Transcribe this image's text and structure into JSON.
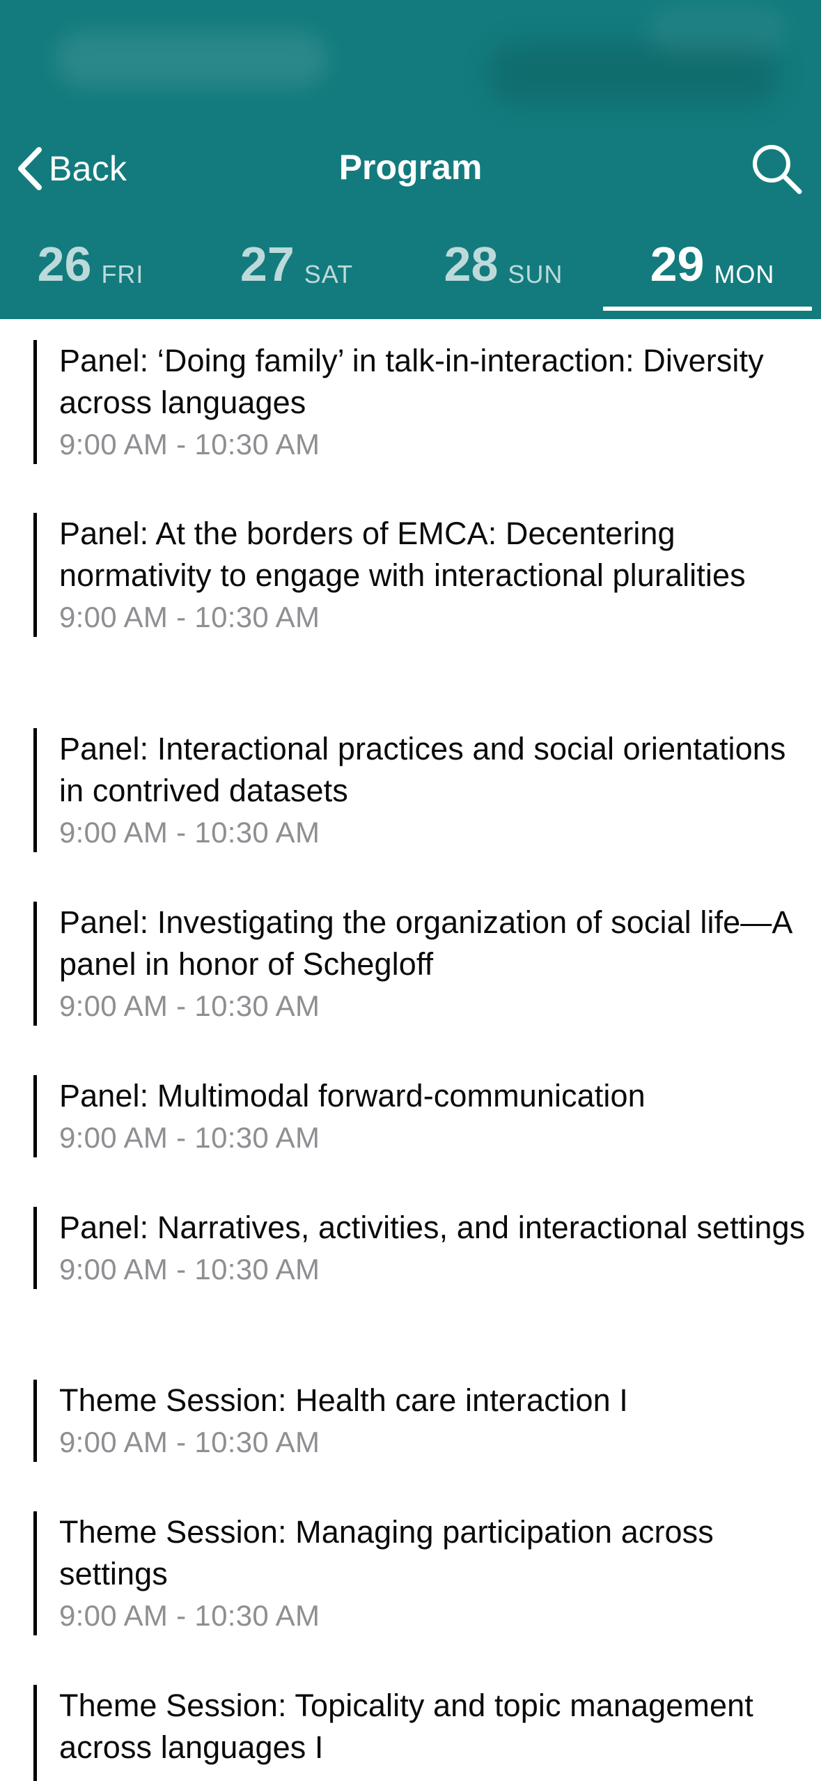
{
  "header": {
    "back_label": "Back",
    "title": "Program",
    "search_icon": "search-icon",
    "back_icon": "chevron-left-icon",
    "background_color": "#137b7d"
  },
  "day_tabs": [
    {
      "num": "26",
      "day": "FRI",
      "active": false
    },
    {
      "num": "27",
      "day": "SAT",
      "active": false
    },
    {
      "num": "28",
      "day": "SUN",
      "active": false
    },
    {
      "num": "29",
      "day": "MON",
      "active": true
    }
  ],
  "sessions": [
    {
      "title": "Panel: ‘Doing family’ in talk-in-interaction: Diversity across languages",
      "time": "9:00 AM - 10:30 AM"
    },
    {
      "title": "Panel: At the borders of EMCA: Decentering normativity to engage with interactional pluralities",
      "time": "9:00 AM - 10:30 AM"
    },
    {
      "title": "Panel: Interactional practices and social orientations in contrived datasets",
      "time": "9:00 AM - 10:30 AM"
    },
    {
      "title": "Panel: Investigating the organization of social life—A panel in honor of Schegloff",
      "time": "9:00 AM - 10:30 AM"
    },
    {
      "title": "Panel: Multimodal forward-communication",
      "time": "9:00 AM - 10:30 AM"
    },
    {
      "title": "Panel: Narratives, activities, and interactional settings",
      "time": "9:00 AM - 10:30 AM"
    },
    {
      "title": "Theme Session: Health care interaction I",
      "time": "9:00 AM - 10:30 AM"
    },
    {
      "title": "Theme Session: Managing participation across settings",
      "time": "9:00 AM - 10:30 AM"
    },
    {
      "title": "Theme Session: Topicality and topic management across languages I",
      "time": ""
    }
  ]
}
